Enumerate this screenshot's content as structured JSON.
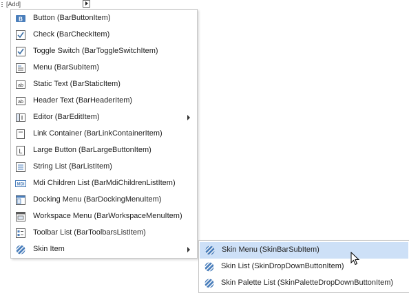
{
  "toolbar": {
    "add_label": "[Add]"
  },
  "main_menu": {
    "items": [
      {
        "label": "Button (BarButtonItem)",
        "icon": "button-icon"
      },
      {
        "label": "Check (BarCheckItem)",
        "icon": "check-icon"
      },
      {
        "label": "Toggle Switch (BarToggleSwitchItem)",
        "icon": "toggle-check-icon"
      },
      {
        "label": "Menu (BarSubItem)",
        "icon": "menu-icon"
      },
      {
        "label": "Static Text (BarStaticItem)",
        "icon": "static-text-icon"
      },
      {
        "label": "Header Text (BarHeaderItem)",
        "icon": "header-text-icon"
      },
      {
        "label": "Editor (BarEditItem)",
        "icon": "editor-icon"
      },
      {
        "label": "Link Container (BarLinkContainerItem)",
        "icon": "link-container-icon"
      },
      {
        "label": "Large Button (BarLargeButtonItem)",
        "icon": "large-button-icon"
      },
      {
        "label": "String List (BarListItem)",
        "icon": "string-list-icon"
      },
      {
        "label": "Mdi Children List (BarMdiChildrenListItem)",
        "icon": "mdi-list-icon"
      },
      {
        "label": "Docking Menu (BarDockingMenuItem)",
        "icon": "docking-menu-icon"
      },
      {
        "label": "Workspace Menu (BarWorkspaceMenuItem)",
        "icon": "workspace-menu-icon"
      },
      {
        "label": "Toolbar List (BarToolbarsListItem)",
        "icon": "toolbar-list-icon"
      },
      {
        "label": "Skin Item",
        "icon": "skin-icon"
      }
    ]
  },
  "icon_text": {
    "button": "B",
    "static": "ab",
    "header": "ab",
    "large": "L",
    "mdi": "MDI"
  },
  "sub_menu": {
    "items": [
      {
        "label": "Skin Menu (SkinBarSubItem)",
        "icon": "skin-icon"
      },
      {
        "label": "Skin List (SkinDropDownButtonItem)",
        "icon": "skin-icon"
      },
      {
        "label": "Skin Palette List (SkinPaletteDropDownButtonItem)",
        "icon": "skin-icon"
      }
    ]
  },
  "colors": {
    "hover": "#cde0f7",
    "accent": "#4a7ebb",
    "border": "#c6c6c6"
  }
}
